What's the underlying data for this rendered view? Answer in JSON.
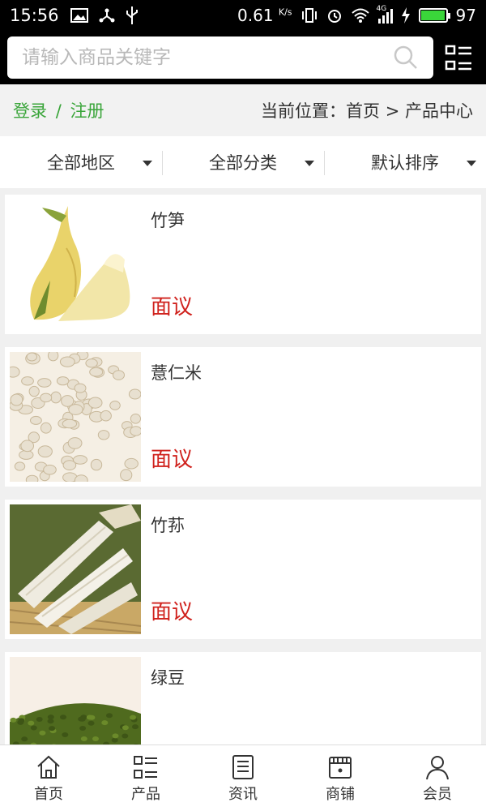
{
  "status_bar": {
    "time": "15:56",
    "speed": "0.61",
    "speed_unit": "K/s",
    "battery": "97",
    "battery_level": 0.97,
    "network": "4G"
  },
  "search": {
    "placeholder": "请输入商品关键字"
  },
  "breadcrumb": {
    "login": "登录",
    "separator": "/",
    "register": "注册",
    "location": "当前位置：首页 > 产品中心"
  },
  "filters": [
    {
      "label": "全部地区"
    },
    {
      "label": "全部分类"
    },
    {
      "label": "默认排序"
    }
  ],
  "products": [
    {
      "name": "竹笋",
      "price": "面议"
    },
    {
      "name": "薏仁米",
      "price": "面议"
    },
    {
      "name": "竹荪",
      "price": "面议"
    },
    {
      "name": "绿豆",
      "price": ""
    }
  ],
  "bottom_nav": [
    {
      "label": "首页",
      "icon": "home-icon"
    },
    {
      "label": "产品",
      "icon": "list-icon"
    },
    {
      "label": "资讯",
      "icon": "news-icon"
    },
    {
      "label": "商铺",
      "icon": "shop-icon"
    },
    {
      "label": "会员",
      "icon": "user-icon"
    }
  ],
  "colors": {
    "login_green": "#3aa53a",
    "price_red": "#d0231e",
    "header_bg": "#000000"
  }
}
